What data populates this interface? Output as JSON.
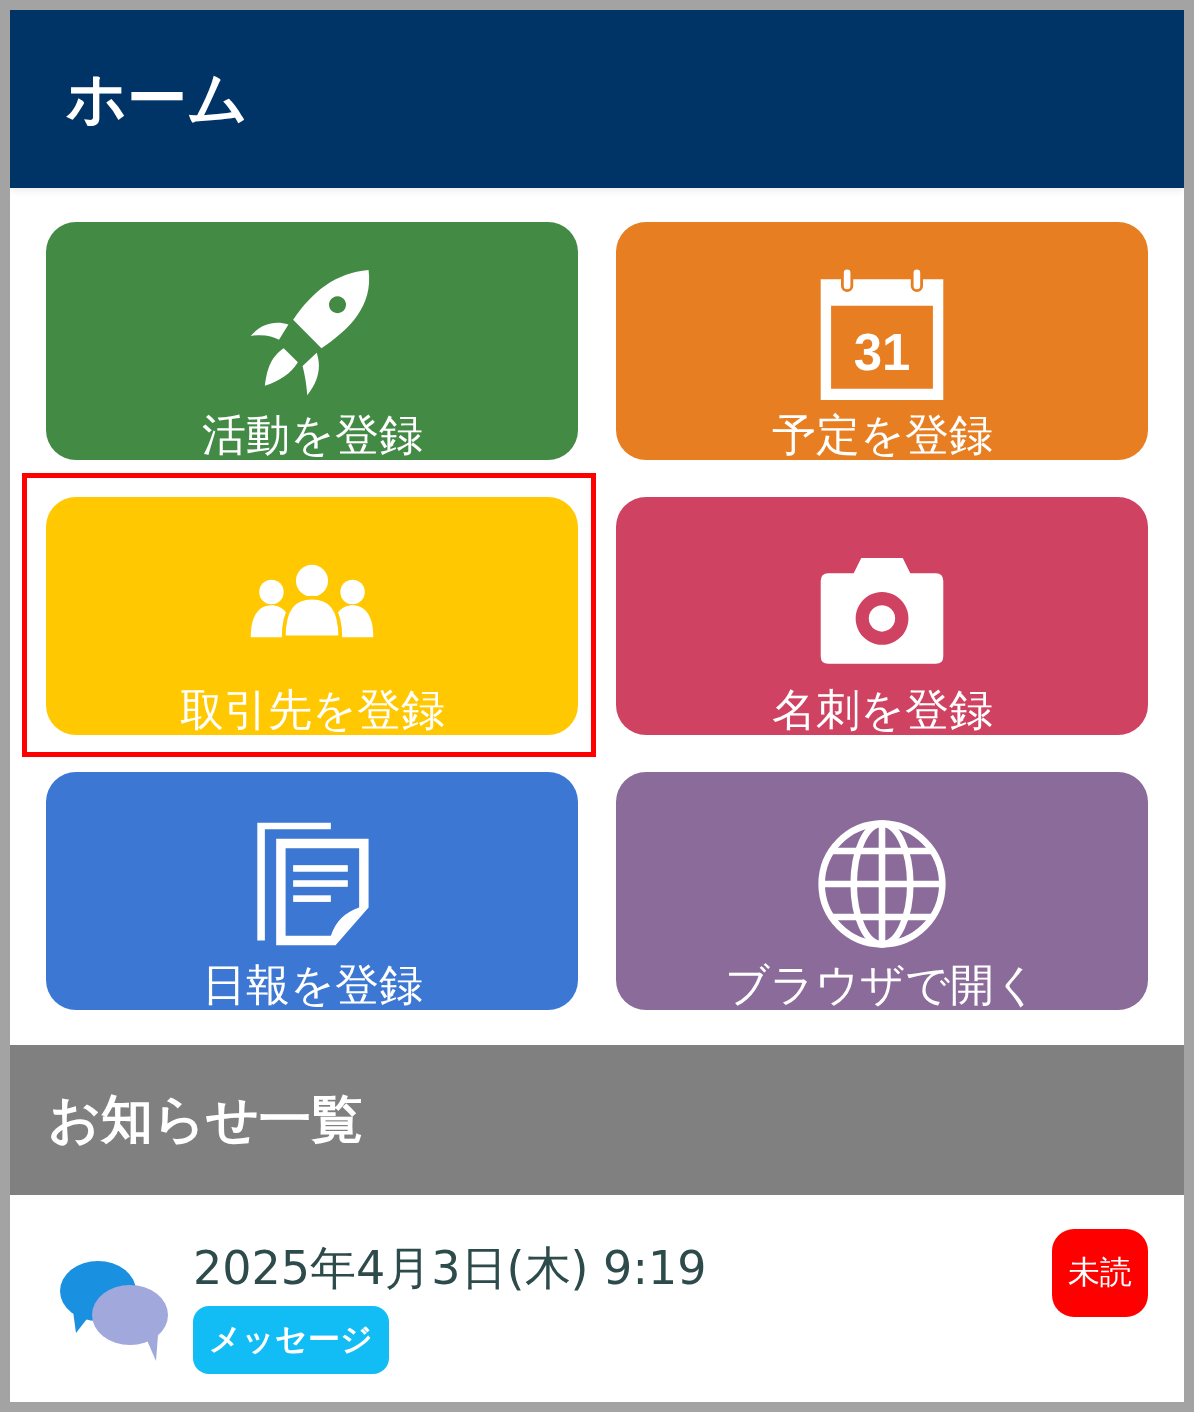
{
  "header": {
    "title": "ホーム"
  },
  "calendar_icon": {
    "day": "31"
  },
  "tiles": [
    {
      "label": "活動を登録",
      "kind": "rocket",
      "color": "#438a45",
      "highlighted": false
    },
    {
      "label": "予定を登録",
      "kind": "calendar",
      "color": "#e77f22",
      "highlighted": false
    },
    {
      "label": "取引先を登録",
      "kind": "people",
      "color": "#ffc800",
      "highlighted": true
    },
    {
      "label": "名刺を登録",
      "kind": "camera",
      "color": "#d04262",
      "highlighted": false
    },
    {
      "label": "日報を登録",
      "kind": "document",
      "color": "#3b77d3",
      "highlighted": false
    },
    {
      "label": "ブラウザで開く",
      "kind": "globe",
      "color": "#8a6b9a",
      "highlighted": false
    }
  ],
  "notices": {
    "title": "お知らせ一覧",
    "items": [
      {
        "date": "2025年4月3日(木) 9:19",
        "tag": "メッセージ",
        "status": "未読",
        "unread": true
      }
    ]
  }
}
